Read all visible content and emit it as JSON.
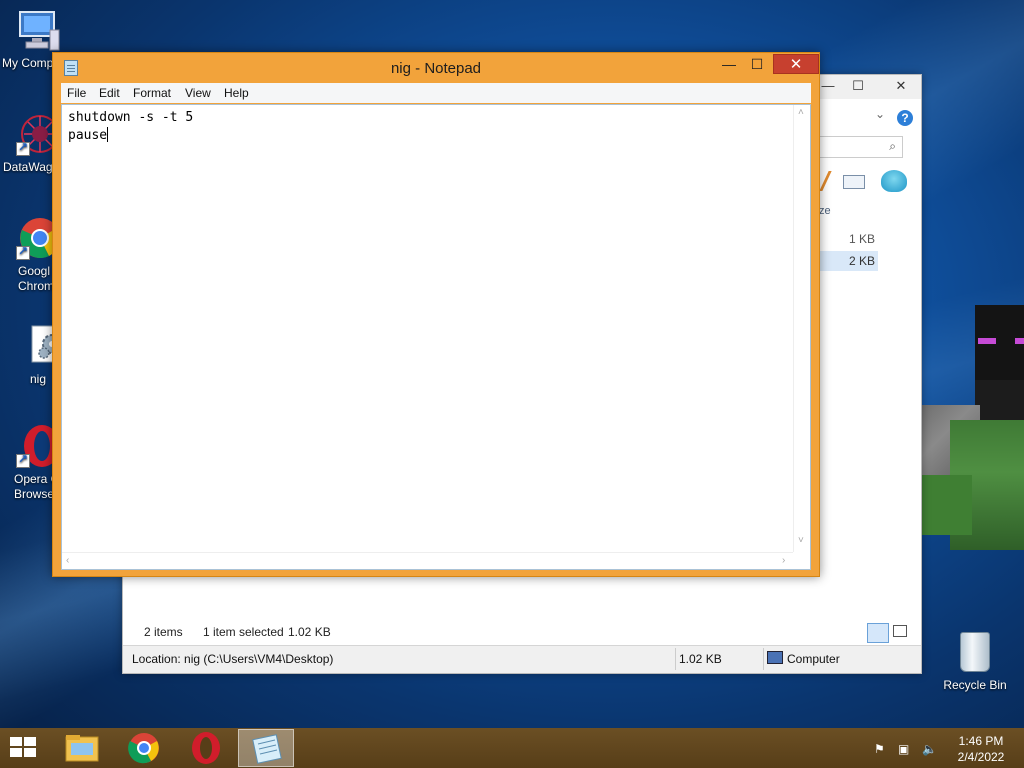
{
  "desktop": {
    "icons": [
      {
        "label": "My Comp"
      },
      {
        "label": "DataWag"
      },
      {
        "label": "Googl\nChrom"
      },
      {
        "label": "nig"
      },
      {
        "label": "Opera C\nBrowse"
      }
    ],
    "recycle_bin_label": "Recycle Bin"
  },
  "explorer": {
    "minimize_glyph": "—",
    "maximize_glyph": "☐",
    "close_glyph": "✕",
    "help_glyph": "?",
    "column_header_partial": "ze",
    "files": [
      {
        "size": "1 KB"
      },
      {
        "size": "2 KB"
      }
    ],
    "status_items_count": "2 items",
    "status_selected": "1 item selected",
    "status_selected_size": "1.02 KB",
    "location": "Location: nig (C:\\Users\\VM4\\Desktop)",
    "bar_size": "1.02 KB",
    "bar_computer": "Computer"
  },
  "notepad": {
    "title": "nig - Notepad",
    "minimize_glyph": "—",
    "maximize_glyph": "☐",
    "close_glyph": "✕",
    "menu": [
      "File",
      "Edit",
      "Format",
      "View",
      "Help"
    ],
    "content_line1": "shutdown -s -t 5",
    "content_line2": "pause"
  },
  "taskbar": {
    "apps": [
      "File Explorer",
      "Google Chrome",
      "Opera",
      "Notepad"
    ],
    "active_app": "Notepad",
    "time": "1:46 PM",
    "date": "2/4/2022"
  }
}
